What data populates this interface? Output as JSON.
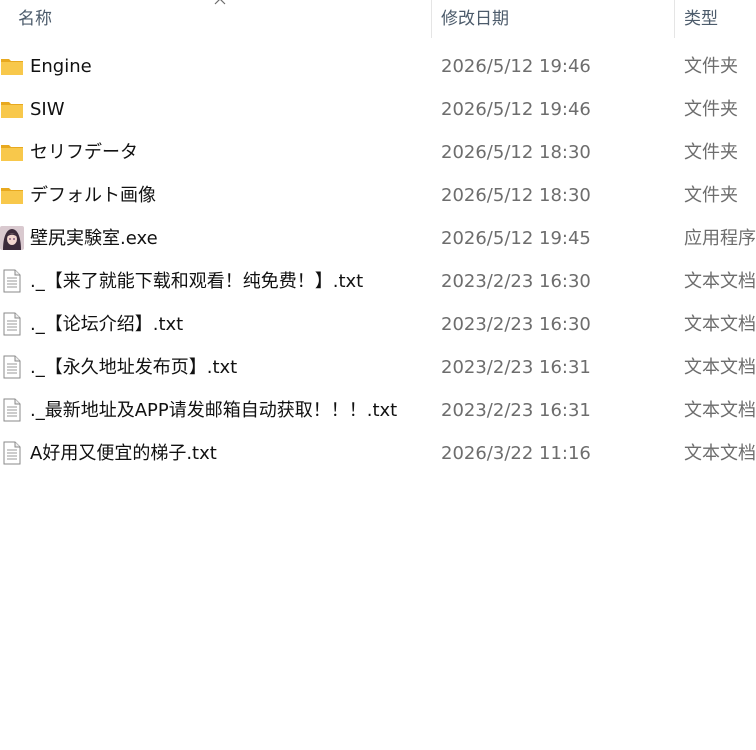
{
  "header": {
    "name_label": "名称",
    "date_label": "修改日期",
    "type_label": "类型"
  },
  "files": [
    {
      "icon": "folder-icon",
      "name": "Engine",
      "date": "2026/5/12 19:46",
      "type": "文件夹"
    },
    {
      "icon": "folder-icon",
      "name": "SIW",
      "date": "2026/5/12 19:46",
      "type": "文件夹"
    },
    {
      "icon": "folder-icon",
      "name": "セリフデータ",
      "date": "2026/5/12 18:30",
      "type": "文件夹"
    },
    {
      "icon": "folder-icon",
      "name": "デフォルト画像",
      "date": "2026/5/12 18:30",
      "type": "文件夹"
    },
    {
      "icon": "app-icon",
      "name": "壁尻実験室.exe",
      "date": "2026/5/12 19:45",
      "type": "应用程序"
    },
    {
      "icon": "text-file-icon",
      "name": "._【来了就能下载和观看！纯免费！】.txt",
      "date": "2023/2/23 16:30",
      "type": "文本文档"
    },
    {
      "icon": "text-file-icon",
      "name": "._【论坛介绍】.txt",
      "date": "2023/2/23 16:30",
      "type": "文本文档"
    },
    {
      "icon": "text-file-icon",
      "name": "._【永久地址发布页】.txt",
      "date": "2023/2/23 16:31",
      "type": "文本文档"
    },
    {
      "icon": "text-file-icon",
      "name": "._最新地址及APP请发邮箱自动获取！！！.txt",
      "date": "2023/2/23 16:31",
      "type": "文本文档"
    },
    {
      "icon": "text-file-icon",
      "name": "A好用又便宜的梯子.txt",
      "date": "2026/3/22 11:16",
      "type": "文本文档"
    }
  ],
  "colors": {
    "folder": "#f8c84b",
    "folder_dark": "#e8a91f",
    "header_text": "#4c5b6b",
    "secondary_text": "#6d6d6d"
  }
}
